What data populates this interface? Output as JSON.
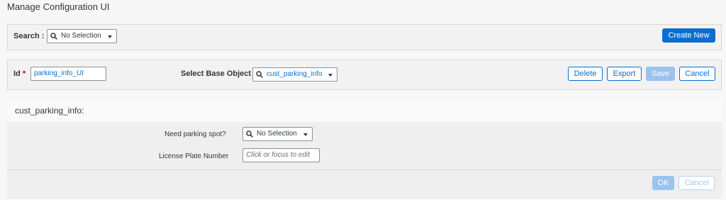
{
  "page": {
    "title": "Manage Configuration UI"
  },
  "search": {
    "label": "Search :",
    "value": "No Selection",
    "create_new_label": "Create New"
  },
  "id_bar": {
    "id_label": "Id",
    "required_mark": "*",
    "id_value": "parking_info_UI",
    "base_object_label": "Select Base Object",
    "base_object_value": "cust_parking_info",
    "delete_label": "Delete",
    "export_label": "Export",
    "save_label": "Save",
    "cancel_label": "Cancel"
  },
  "section": {
    "title": "cust_parking_info:",
    "fields": {
      "parking_label": "Need parking spot?",
      "parking_value": "No Selection",
      "license_label": "License Plate Number",
      "license_placeholder": "Click or focus to edit"
    },
    "ok_label": "OK",
    "cancel_label": "Cancel"
  },
  "colors": {
    "accent": "#0a6ed1",
    "required": "#bb0000",
    "disabled_primary": "#9cc3ee"
  }
}
